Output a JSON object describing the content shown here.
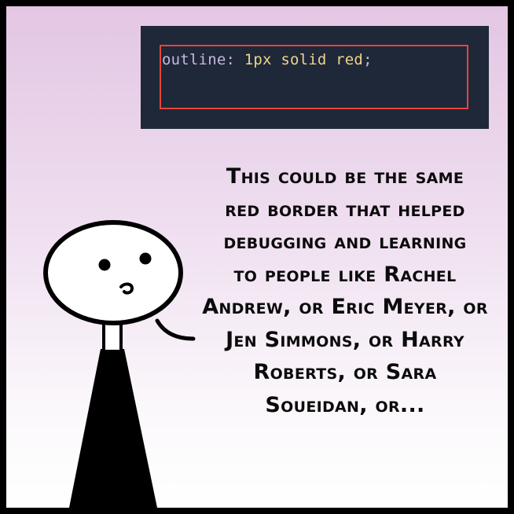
{
  "code": {
    "property": "outline",
    "colon": ":",
    "value": "1px solid red",
    "semicolon": ";"
  },
  "caption": {
    "lines": [
      "This could be the same",
      "red border that helped",
      "debugging and learning",
      "to people like Rachel",
      "Andrew, or Eric Meyer, or",
      "Jen Simmons, or Harry",
      "Roberts, or Sara",
      "Soueidan, or..."
    ]
  },
  "colors": {
    "code_background": "#1e2839",
    "code_outline": "#e8443a",
    "gradient_top": "#e3c6e3",
    "gradient_bottom": "#ffffff"
  }
}
